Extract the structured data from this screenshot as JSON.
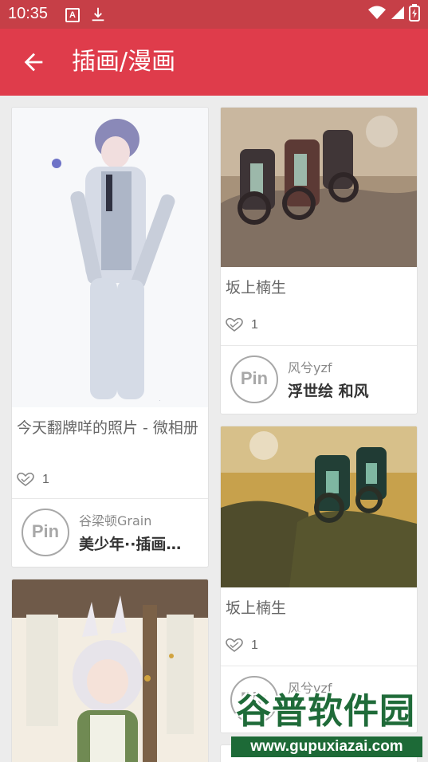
{
  "status_bar": {
    "time": "10:35",
    "a_icon": "A",
    "icons": [
      "a-notification-icon",
      "download-icon",
      "wifi-icon",
      "signal-icon",
      "battery-icon"
    ],
    "color": "#c63f47"
  },
  "app_bar": {
    "title": "插画/漫画",
    "back_icon": "arrow-left-icon",
    "color": "#df3c4b"
  },
  "cards": [
    {
      "title": "今天翻牌咩的照片 - 微相册",
      "likes": "1",
      "author": "谷梁顿Grain",
      "board": "美少年··插画…",
      "avatar_text": "Pin"
    },
    {
      "title": "坂上楠生",
      "likes": "1",
      "author": "风兮yzf",
      "board": "浮世绘 和风",
      "avatar_text": "Pin"
    },
    {
      "title": "坂上楠生",
      "likes": "1",
      "author": "风兮yzf",
      "board": "",
      "avatar_text": "Pin"
    },
    {
      "title": "",
      "likes": "",
      "author": "",
      "board": "",
      "avatar_text": ""
    }
  ],
  "watermark": {
    "top": "谷普软件园",
    "bottom": "www.gupuxiazai.com"
  }
}
